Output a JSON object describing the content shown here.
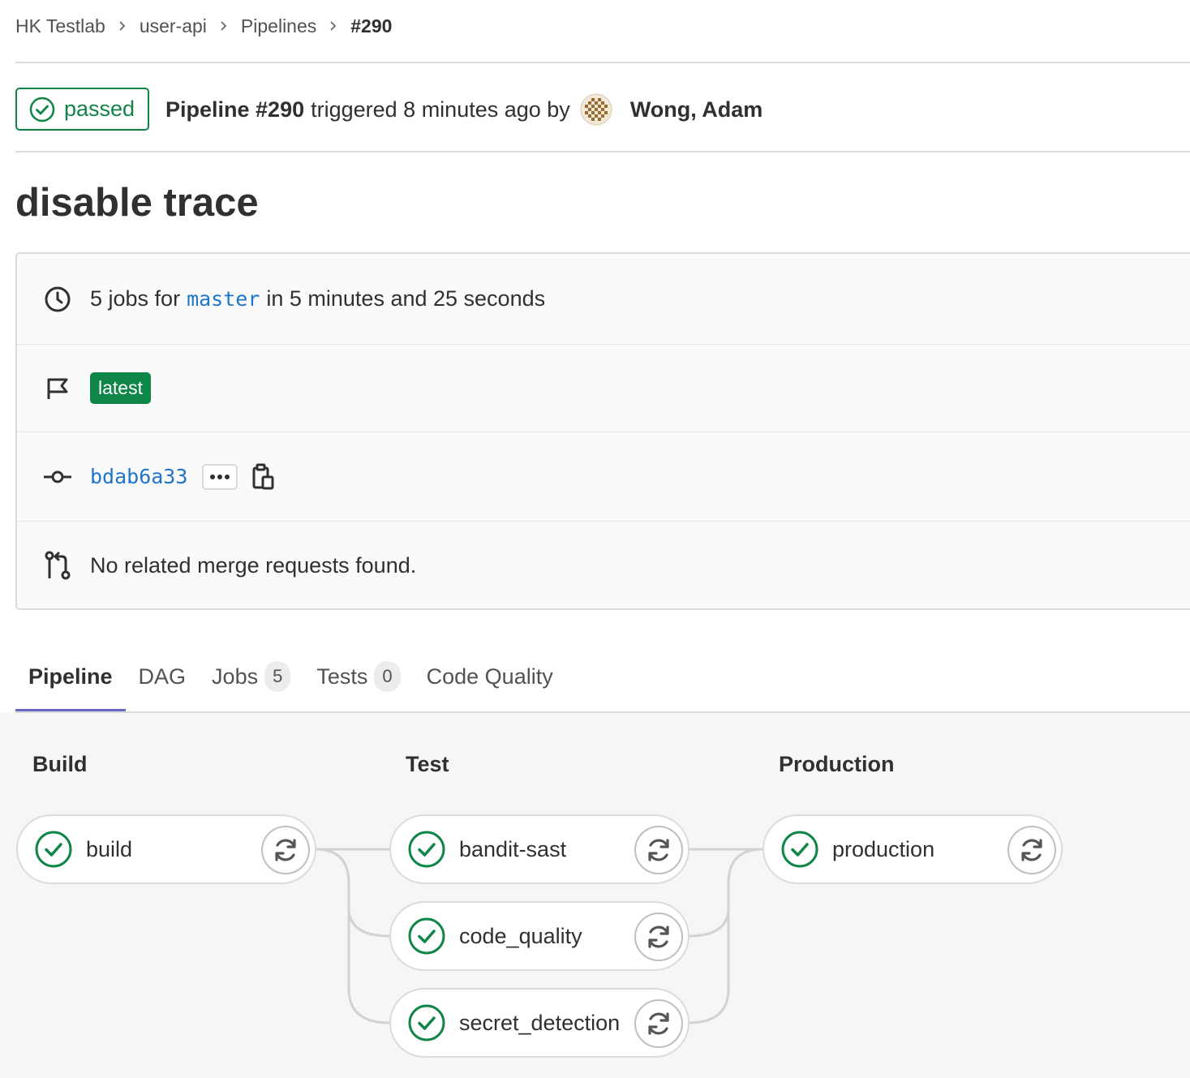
{
  "breadcrumb": {
    "items": [
      "HK Testlab",
      "user-api",
      "Pipelines",
      "#290"
    ]
  },
  "header": {
    "status": "passed",
    "pipeline_label": "Pipeline #290",
    "triggered_text": "triggered 8 minutes ago by",
    "user": "Wong, Adam"
  },
  "title": "disable trace",
  "info": {
    "jobs_prefix": "5 jobs for",
    "branch": "master",
    "jobs_suffix": "in 5 minutes and 25 seconds",
    "badge": "latest",
    "commit": "bdab6a33",
    "merge_requests": "No related merge requests found."
  },
  "tabs": [
    {
      "label": "Pipeline",
      "count": null
    },
    {
      "label": "DAG",
      "count": null
    },
    {
      "label": "Jobs",
      "count": "5"
    },
    {
      "label": "Tests",
      "count": "0"
    },
    {
      "label": "Code Quality",
      "count": null
    }
  ],
  "stages": [
    {
      "name": "Build",
      "jobs": [
        "build"
      ]
    },
    {
      "name": "Test",
      "jobs": [
        "bandit-sast",
        "code_quality",
        "secret_detection"
      ]
    },
    {
      "name": "Production",
      "jobs": [
        "production"
      ]
    }
  ],
  "colors": {
    "success": "#108548",
    "link": "#1f75cb",
    "tab_active": "#6666c4"
  },
  "icons": {
    "status": "status-success-icon",
    "clock": "clock-icon",
    "flag": "flag-icon",
    "commit": "commit-icon",
    "merge_request": "merge-request-icon",
    "retry": "retry-icon",
    "copy": "copy-to-clipboard-icon",
    "ellipsis": "ellipsis-icon"
  }
}
